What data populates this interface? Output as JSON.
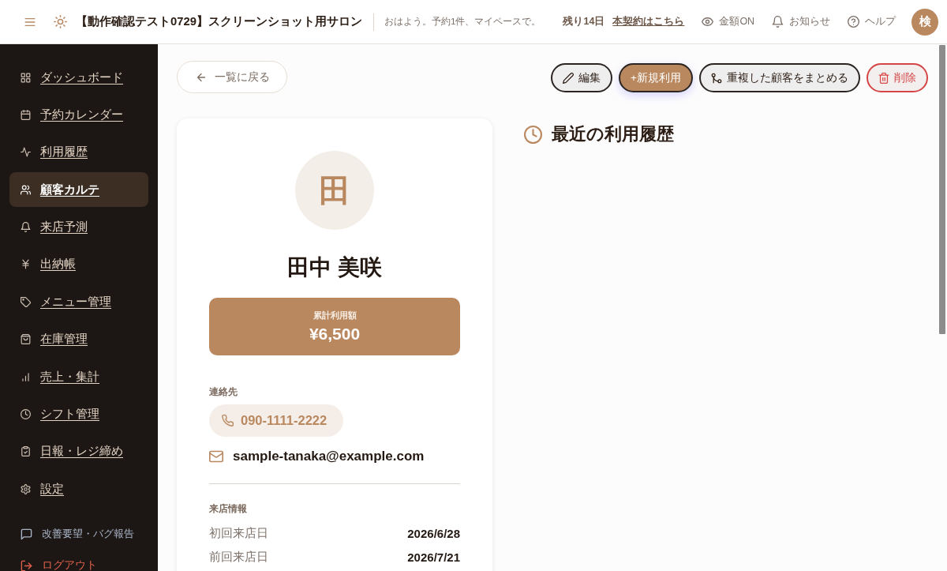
{
  "header": {
    "title": "【動作確認テスト0729】スクリーンショット用サロン",
    "greeting": "おはよう。予約1件、マイペースで。",
    "trial_remaining": "残り14日",
    "upgrade_link": "本契約はこちら",
    "actions": [
      {
        "label": "金額ON"
      },
      {
        "label": "お知らせ"
      },
      {
        "label": "ヘルプ"
      }
    ],
    "avatar_initial": "検"
  },
  "sidebar": {
    "items": [
      {
        "label": "ダッシュボード",
        "selected": false
      },
      {
        "label": "予約カレンダー",
        "selected": false
      },
      {
        "label": "利用履歴",
        "selected": false
      },
      {
        "label": "顧客カルテ",
        "selected": true
      },
      {
        "label": "来店予測",
        "selected": false
      },
      {
        "label": "出納帳",
        "selected": false
      },
      {
        "label": "メニュー管理",
        "selected": false
      },
      {
        "label": "在庫管理",
        "selected": false
      },
      {
        "label": "売上・集計",
        "selected": false
      },
      {
        "label": "シフト管理",
        "selected": false
      },
      {
        "label": "日報・レジ締め",
        "selected": false
      },
      {
        "label": "設定",
        "selected": false
      }
    ],
    "footer": [
      {
        "kind": "feedback",
        "label": "改善要望・バグ報告"
      },
      {
        "kind": "logout",
        "label": "ログアウト"
      }
    ]
  },
  "toolbar": {
    "back_button": "一覧に戻る",
    "buttons": [
      {
        "kind": "edit",
        "label": "編集"
      },
      {
        "kind": "primary",
        "label": "+新規利用"
      },
      {
        "kind": "merge",
        "label": "重複した顧客をまとめる"
      },
      {
        "kind": "danger",
        "label": "削除"
      }
    ]
  },
  "profile": {
    "avatar_initial": "田",
    "name": "田中 美咲",
    "total_label": "累計利用額",
    "total_value": "¥6,500",
    "contact_label": "連絡先",
    "phone": "090-1111-2222",
    "email": "sample-tanaka@example.com",
    "visit_label": "来店情報",
    "visit_rows": [
      {
        "label": "初回来店日",
        "value": "2026/6/28"
      },
      {
        "label": "前回来店日",
        "value": "2026/7/21"
      }
    ]
  },
  "history": {
    "title": "最近の利用履歴"
  }
}
